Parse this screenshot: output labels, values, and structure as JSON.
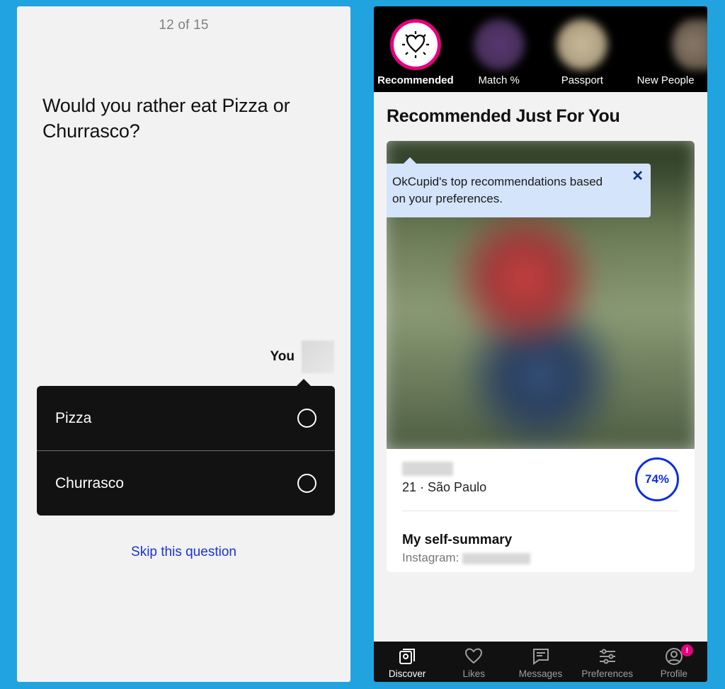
{
  "left": {
    "counter": "12 of 15",
    "question": "Would you rather eat Pizza or Churrasco?",
    "you_label": "You",
    "answers": [
      "Pizza",
      "Churrasco"
    ],
    "skip_label": "Skip this question"
  },
  "right": {
    "tabs": {
      "recommended": "Recommended",
      "match": "Match %",
      "passport": "Passport",
      "newpeople": "New People"
    },
    "section_title": "Recommended Just For You",
    "tooltip": {
      "text": "OkCupid's top recommendations based on your preferences.",
      "close": "✕"
    },
    "profile": {
      "meta": "21 · São Paulo",
      "match_percent": "74%",
      "summary_heading": "My self-summary",
      "summary_line1_prefix": "Instagram: "
    },
    "nav": {
      "discover": "Discover",
      "likes": "Likes",
      "messages": "Messages",
      "preferences": "Preferences",
      "profile": "Profile",
      "profile_badge": "!"
    }
  }
}
